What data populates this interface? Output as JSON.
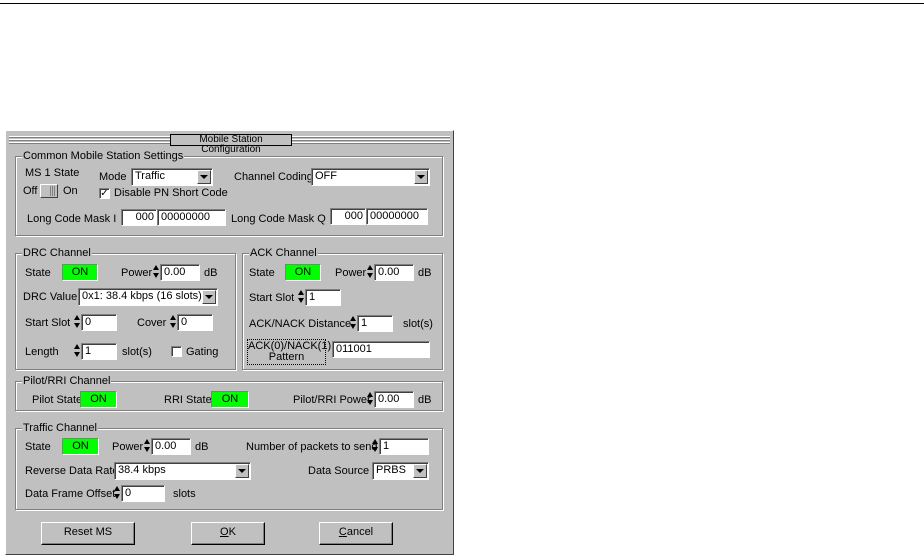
{
  "dialog": {
    "title": "Mobile Station Configuration"
  },
  "common": {
    "group_title": "Common Mobile Station Settings",
    "ms_state_label": "MS 1 State",
    "off_label": "Off",
    "on_label": "On",
    "mode_label": "Mode",
    "mode_value": "Traffic",
    "disable_pn_label": "Disable PN Short Code",
    "disable_pn_checked": "✓",
    "channel_coding_label": "Channel Coding",
    "channel_coding_value": "OFF",
    "long_code_i_label": "Long Code Mask I",
    "long_code_i_hi": "000",
    "long_code_i_lo": "00000000",
    "long_code_q_label": "Long Code Mask Q",
    "long_code_q_hi": "000",
    "long_code_q_lo": "00000000"
  },
  "drc": {
    "group_title": "DRC Channel",
    "state_label": "State",
    "state_value": "ON",
    "power_label": "Power",
    "power_value": "0.00",
    "power_unit": "dB",
    "drc_value_label": "DRC Value",
    "drc_value": "0x1: 38.4 kbps (16 slots)",
    "start_slot_label": "Start Slot",
    "start_slot_value": "0",
    "cover_label": "Cover",
    "cover_value": "0",
    "length_label": "Length",
    "length_value": "1",
    "length_unit": "slot(s)",
    "gating_label": "Gating"
  },
  "ack": {
    "group_title": "ACK Channel",
    "state_label": "State",
    "state_value": "ON",
    "power_label": "Power",
    "power_value": "0.00",
    "power_unit": "dB",
    "start_slot_label": "Start Slot",
    "start_slot_value": "1",
    "distance_label": "ACK/NACK Distance",
    "distance_value": "1",
    "distance_unit": "slot(s)",
    "pattern_label_1": "ACK(0)/NACK(1)",
    "pattern_label_2": "Pattern",
    "pattern_value": "011001"
  },
  "pilot": {
    "group_title": "Pilot/RRI Channel",
    "pilot_state_label": "Pilot State",
    "pilot_state_value": "ON",
    "rri_state_label": "RRI State",
    "rri_state_value": "ON",
    "power_label": "Pilot/RRI Power",
    "power_value": "0.00",
    "power_unit": "dB"
  },
  "traffic": {
    "group_title": "Traffic Channel",
    "state_label": "State",
    "state_value": "ON",
    "power_label": "Power",
    "power_value": "0.00",
    "power_unit": "dB",
    "packets_label": "Number of packets to send",
    "packets_value": "1",
    "rate_label": "Reverse Data Rate",
    "rate_value": "38.4 kbps",
    "source_label": "Data Source",
    "source_value": "PRBS",
    "offset_label": "Data Frame Offset",
    "offset_value": "0",
    "offset_unit": "slots"
  },
  "buttons": {
    "reset": "Reset MS",
    "ok_mnemonic": "O",
    "ok_rest": "K",
    "cancel_mnemonic": "C",
    "cancel_rest": "ancel"
  },
  "colors": {
    "led_on": "#00ff00",
    "face": "#c0c0c0"
  }
}
